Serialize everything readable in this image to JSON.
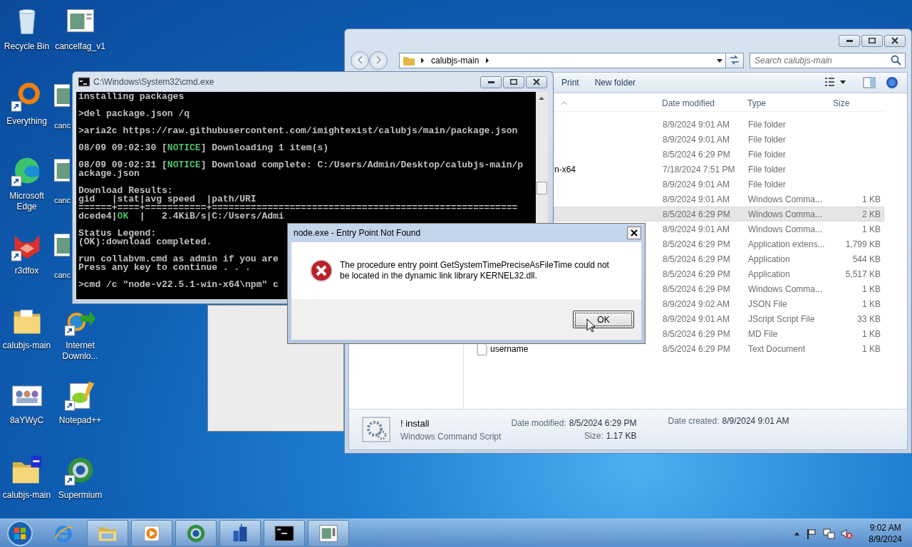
{
  "desktop": {
    "icons": [
      {
        "label": "Recycle Bin",
        "kind": "recycle",
        "shortcut": false,
        "covered": false
      },
      {
        "label": "Everything",
        "kind": "ring",
        "shortcut": true,
        "covered": false
      },
      {
        "label": "Microsoft Edge",
        "kind": "edge",
        "shortcut": true,
        "covered": false
      },
      {
        "label": "r3dfox",
        "kind": "fox",
        "shortcut": true,
        "covered": false
      },
      {
        "label": "calubjs-main",
        "kind": "folder",
        "shortcut": false,
        "covered": false
      },
      {
        "label": "8aYWyC",
        "kind": "picture",
        "shortcut": false,
        "covered": false
      },
      {
        "label": "calubjs-main",
        "kind": "zip",
        "shortcut": false,
        "covered": false
      },
      {
        "label": "cancelfag_v1",
        "kind": "window",
        "shortcut": false,
        "covered": false
      },
      {
        "label": "canc",
        "kind": "window",
        "shortcut": false,
        "covered": true
      },
      {
        "label": "canc",
        "kind": "window",
        "shortcut": false,
        "covered": true
      },
      {
        "label": "canc",
        "kind": "window",
        "shortcut": false,
        "covered": true
      },
      {
        "label": "Internet Downlo...",
        "kind": "globe",
        "shortcut": true,
        "covered": false
      },
      {
        "label": "Notepad++",
        "kind": "notepad",
        "shortcut": true,
        "covered": false
      },
      {
        "label": "Supermium",
        "kind": "browser",
        "shortcut": true,
        "covered": false
      }
    ]
  },
  "explorer": {
    "breadcrumb": "calubjs-main",
    "search": {
      "placeholder": "Search calubjs-main"
    },
    "toolbar": [
      "Print",
      "New folder"
    ],
    "columns": [
      "Date modified",
      "Type",
      "Size"
    ],
    "rows": [
      {
        "date": "8/9/2024 9:01 AM",
        "type": "File folder",
        "selected": false
      },
      {
        "date": "8/9/2024 9:01 AM",
        "type": "File folder",
        "selected": false
      },
      {
        "date": "8/5/2024 6:29 PM",
        "type": "File folder",
        "selected": false
      },
      {
        "name": "n-x64",
        "covered": true,
        "date": "7/18/2024 7:51 PM",
        "type": "File folder",
        "selected": false
      },
      {
        "date": "8/9/2024 9:01 AM",
        "type": "File folder",
        "selected": false
      },
      {
        "date": "8/9/2024 9:01 AM",
        "type": "Windows Comma...",
        "size": "1 KB",
        "selected": false
      },
      {
        "date": "8/5/2024 6:29 PM",
        "type": "Windows Comma...",
        "size": "2 KB",
        "selected": true
      },
      {
        "date": "8/9/2024 9:01 AM",
        "type": "Windows Comma...",
        "size": "1 KB",
        "selected": false
      },
      {
        "date": "8/5/2024 6:29 PM",
        "type": "Application extens...",
        "size": "1,799 KB",
        "selected": false
      },
      {
        "date": "8/5/2024 6:29 PM",
        "type": "Application",
        "size": "544 KB",
        "selected": false
      },
      {
        "date": "8/5/2024 6:29 PM",
        "type": "Application",
        "size": "5,517 KB",
        "selected": false
      },
      {
        "date": "8/5/2024 6:29 PM",
        "type": "Windows Comma...",
        "size": "1 KB",
        "selected": false
      },
      {
        "date": "8/9/2024 9:02 AM",
        "type": "JSON File",
        "size": "1 KB",
        "selected": false
      },
      {
        "date": "8/9/2024 9:01 AM",
        "type": "JScript Script File",
        "size": "33 KB",
        "selected": false
      },
      {
        "date": "8/5/2024 6:29 PM",
        "type": "MD File",
        "size": "1 KB",
        "selected": false
      },
      {
        "name": "username",
        "covered": false,
        "date": "8/5/2024 6:29 PM",
        "type": "Text Document",
        "size": "1 KB",
        "selected": false
      }
    ],
    "details": {
      "name": "! install",
      "type": "Windows Command Script",
      "modified_label": "Date modified:",
      "modified": "8/5/2024 6:29 PM",
      "size_label": "Size:",
      "size": "1.17 KB",
      "created_label": "Date created:",
      "created": "8/9/2024 9:01 AM"
    }
  },
  "console": {
    "title": "C:\\Windows\\System32\\cmd.exe",
    "blocks": [
      {
        "lines": [
          [
            {
              "text": "installing packages",
              "highlight": false
            }
          ]
        ]
      },
      {
        "lines": [
          [
            {
              "text": ">del package.json /q",
              "highlight": false
            }
          ]
        ]
      },
      {
        "lines": [
          [
            {
              "text": ">aria2c https://raw.githubusercontent.com/imightexist/calubjs/main/package.json",
              "highlight": false
            }
          ]
        ]
      },
      {
        "lines": [
          [
            {
              "text": "08/09 09:02:30 [",
              "highlight": false
            },
            {
              "text": "NOTICE",
              "highlight": true
            },
            {
              "text": "] Downloading 1 item(s)",
              "highlight": false
            }
          ]
        ]
      },
      {
        "lines": [
          [
            {
              "text": "08/09 09:02:31 [",
              "highlight": false
            },
            {
              "text": "NOTICE",
              "highlight": true
            },
            {
              "text": "] Download complete: C:/Users/Admin/Desktop/calubjs-main/p",
              "highlight": false
            }
          ],
          [
            {
              "text": "ackage.json",
              "highlight": false
            }
          ]
        ]
      },
      {
        "lines": [
          [
            {
              "text": "Download Results:",
              "highlight": false
            }
          ],
          [
            {
              "text": "gid   |stat|avg speed  |path/URI",
              "highlight": false
            }
          ],
          [
            {
              "text": "======+====+===========+=======================================================",
              "highlight": false
            }
          ],
          [
            {
              "text": "dcede4|",
              "highlight": false
            },
            {
              "text": "OK",
              "highlight": true
            },
            {
              "text": "  |   2.4KiB/s|C:/Users/Admi",
              "highlight": false
            }
          ]
        ]
      },
      {
        "lines": [
          [
            {
              "text": "Status Legend:",
              "highlight": false
            }
          ],
          [
            {
              "text": "(OK):download completed.",
              "highlight": false
            }
          ]
        ]
      },
      {
        "lines": [
          [
            {
              "text": "run collabvm.cmd as admin if you are",
              "highlight": false
            }
          ],
          [
            {
              "text": "Press any key to continue . . .",
              "highlight": false
            }
          ]
        ]
      },
      {
        "lines": [
          [
            {
              "text": ">cmd /c \"node-v22.5.1-win-x64\\npm\" c",
              "highlight": false
            }
          ]
        ]
      }
    ]
  },
  "dialog": {
    "title": "node.exe - Entry Point Not Found",
    "message": "The procedure entry point GetSystemTimePreciseAsFileTime could not be located in the dynamic link library KERNEL32.dll.",
    "button": "OK"
  },
  "taskbar": {
    "items": [
      {
        "kind": "ie",
        "open": false
      },
      {
        "kind": "folder",
        "open": true
      },
      {
        "kind": "media",
        "open": true
      },
      {
        "kind": "browser",
        "open": true
      },
      {
        "kind": "app",
        "open": true
      },
      {
        "kind": "cmd",
        "open": true
      },
      {
        "kind": "window",
        "open": true
      }
    ],
    "time": "9:02 AM",
    "date": "8/9/2024"
  }
}
